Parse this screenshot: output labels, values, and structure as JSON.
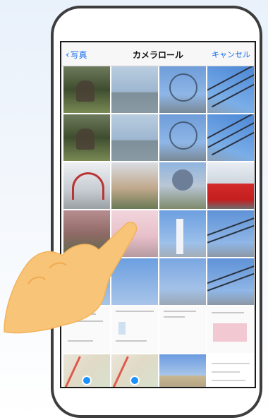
{
  "navbar": {
    "back_label": "写真",
    "title": "カメラロール",
    "cancel_label": "キャンセル"
  },
  "icons": {
    "back": "chevron-left-icon",
    "pointer": "pointing-hand-icon"
  },
  "colors": {
    "accent": "#1a6df0",
    "hand": "#f8c477"
  },
  "thumbnails": [
    "forest",
    "sea",
    "wheel",
    "wheel2",
    "forest",
    "sea",
    "wheel",
    "wheel2",
    "arch",
    "palace",
    "globe",
    "redcar",
    "flowers",
    "blossom",
    "tower",
    "ship",
    "sky",
    "sky",
    "wheelblue",
    "ship",
    "doc",
    "doc",
    "doc",
    "doc",
    "map",
    "map",
    "building",
    "spread"
  ]
}
